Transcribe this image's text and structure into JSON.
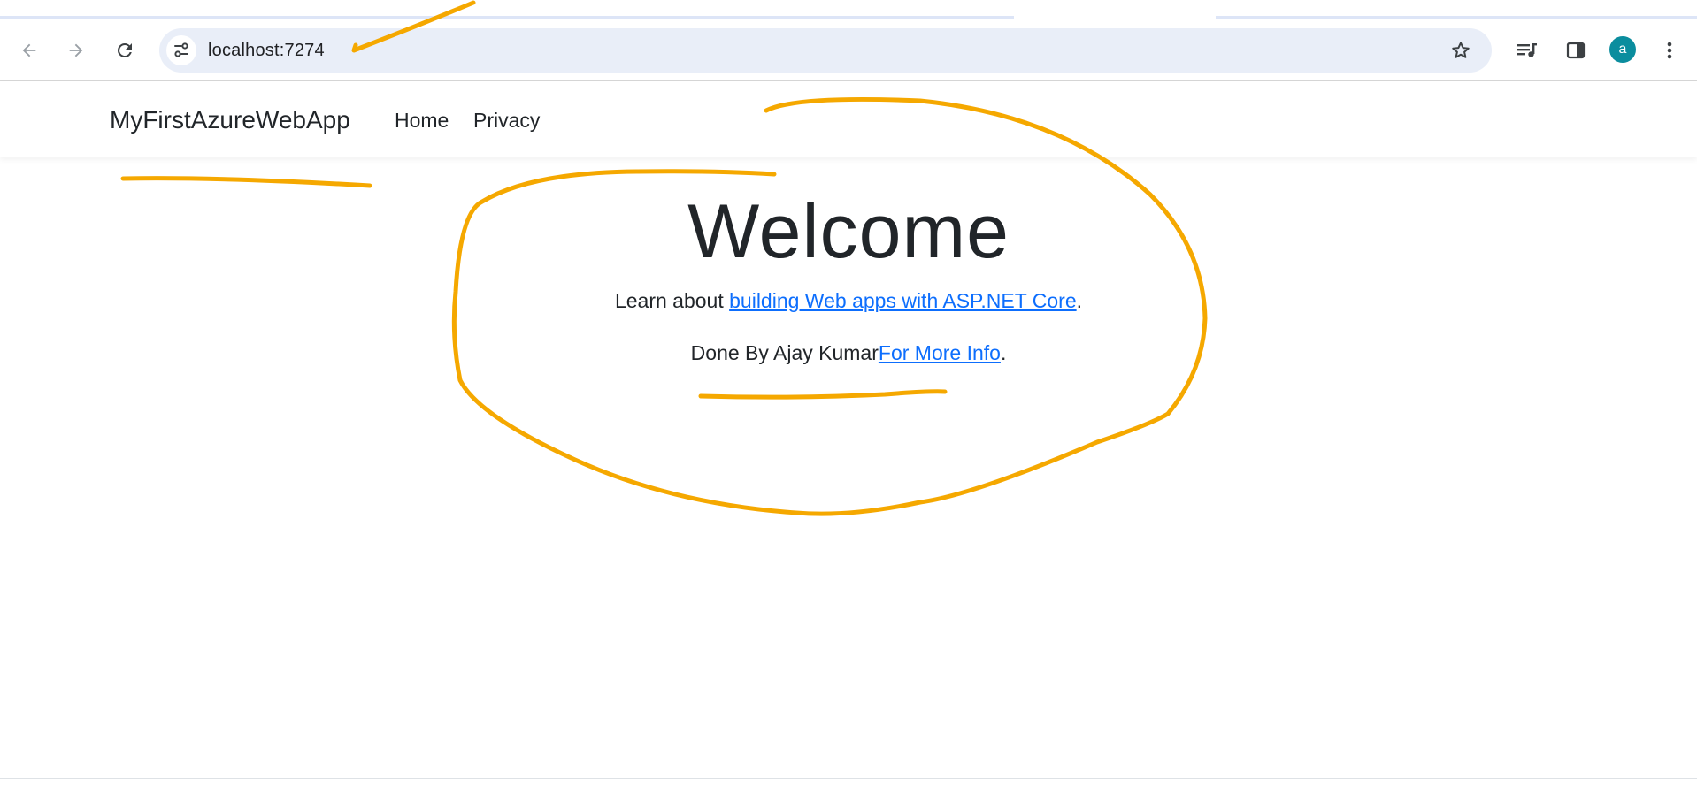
{
  "browser": {
    "url": "localhost:7274",
    "profile_initial": "a",
    "icons": {
      "back": "arrow-left-icon",
      "forward": "arrow-right-icon",
      "reload": "reload-icon",
      "site_info": "tune-icon",
      "bookmark": "star-icon",
      "media": "media-playlist-icon",
      "side_panel": "side-panel-icon",
      "menu": "kebab-menu-icon"
    },
    "colors": {
      "omnibox_bg": "#e9eef8",
      "avatar_bg": "#0b8d9e"
    }
  },
  "site": {
    "brand": "MyFirstAzureWebApp",
    "nav": [
      "Home",
      "Privacy"
    ]
  },
  "main": {
    "heading": "Welcome",
    "learn_prefix": "Learn about ",
    "learn_link": "building Web apps with ASP.NET Core",
    "learn_suffix": ".",
    "done_text": "Done By Ajay Kumar",
    "more_link": "For More Info",
    "more_suffix": "."
  },
  "annotation_color": "#f5a800"
}
